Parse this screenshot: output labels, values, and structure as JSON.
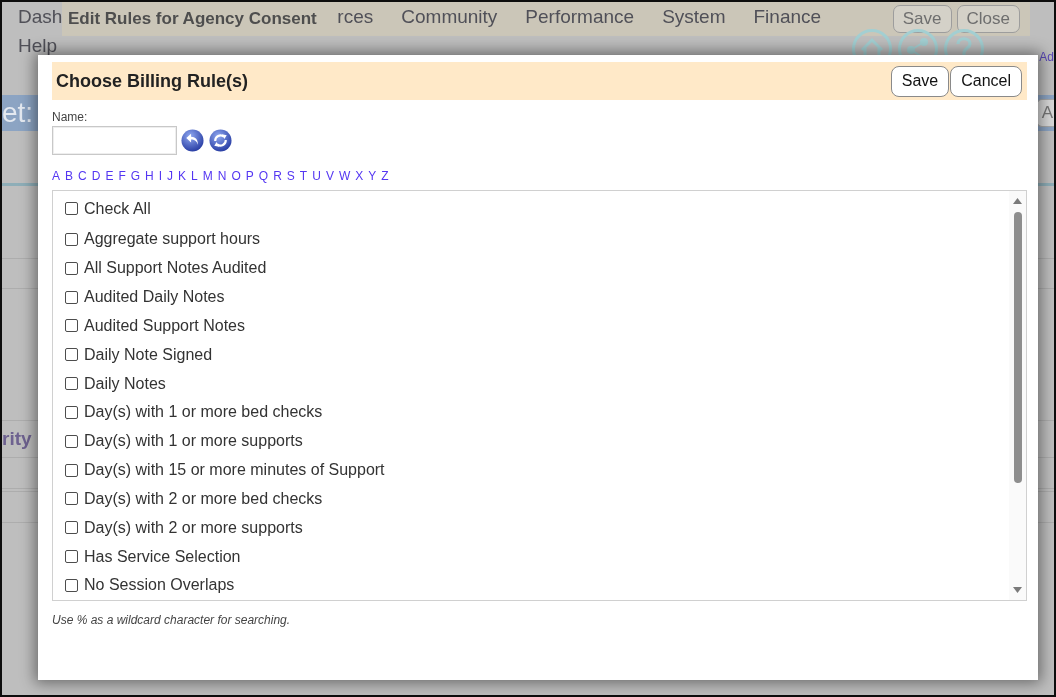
{
  "background_page": {
    "menu_items": [
      "Dash",
      "rces",
      "Community",
      "Performance",
      "System",
      "Finance"
    ],
    "menu_second_line": "Help",
    "corner_link": "Ad",
    "banner_text": "et:",
    "banner_button": "A",
    "column_text": "rity"
  },
  "background_dialog": {
    "title": "Edit Rules for Agency Consent",
    "buttons": [
      "Save",
      "Close"
    ]
  },
  "dialog": {
    "title": "Choose Billing Rule(s)",
    "buttons": [
      "Save",
      "Cancel"
    ],
    "name_field": {
      "label": "Name:"
    },
    "alphabet": [
      "A",
      "B",
      "C",
      "D",
      "E",
      "F",
      "G",
      "H",
      "I",
      "J",
      "K",
      "L",
      "M",
      "N",
      "O",
      "P",
      "Q",
      "R",
      "S",
      "T",
      "U",
      "V",
      "W",
      "X",
      "Y",
      "Z"
    ],
    "check_all": {
      "label": "Check All",
      "checked": false
    },
    "rules": [
      {
        "label": "Aggregate support hours",
        "checked": false
      },
      {
        "label": "All Support Notes Audited",
        "checked": false
      },
      {
        "label": "Audited Daily Notes",
        "checked": false
      },
      {
        "label": "Audited Support Notes",
        "checked": false
      },
      {
        "label": "Daily Note Signed",
        "checked": false
      },
      {
        "label": "Daily Notes",
        "checked": false
      },
      {
        "label": "Day(s) with 1 or more bed checks",
        "checked": false
      },
      {
        "label": "Day(s) with 1 or more supports",
        "checked": false
      },
      {
        "label": "Day(s) with 15 or more minutes of Support",
        "checked": false
      },
      {
        "label": "Day(s) with 2 or more bed checks",
        "checked": false
      },
      {
        "label": "Day(s) with 2 or more supports",
        "checked": false
      },
      {
        "label": "Has Service Selection",
        "checked": false
      },
      {
        "label": "No Session Overlaps",
        "checked": false
      }
    ],
    "hint": "Use % as a wildcard character for searching."
  }
}
